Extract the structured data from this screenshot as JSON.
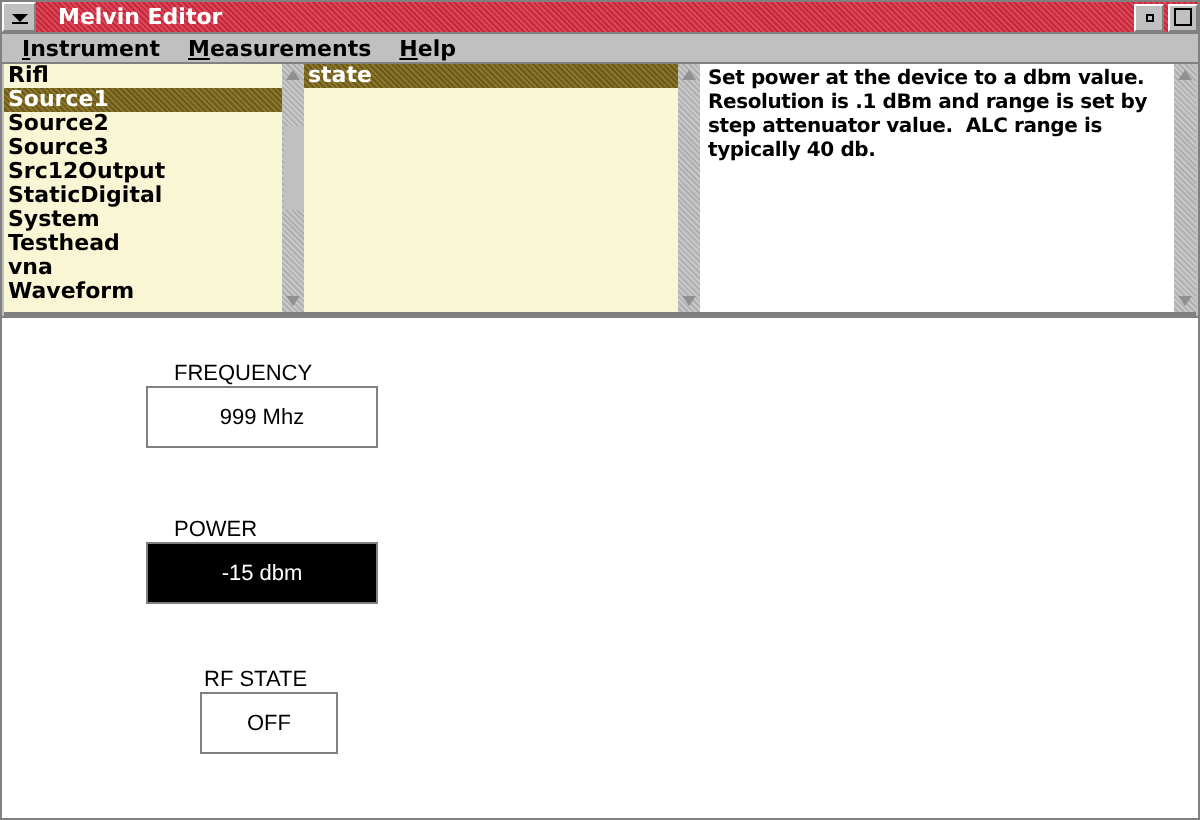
{
  "window": {
    "title": "Melvin Editor"
  },
  "menu": [
    "Instrument",
    "Measurements",
    "Help"
  ],
  "instruments": [
    {
      "label": "Rifl",
      "selected": false
    },
    {
      "label": "Source1",
      "selected": true
    },
    {
      "label": "Source2",
      "selected": false
    },
    {
      "label": "Source3",
      "selected": false
    },
    {
      "label": "Src12Output",
      "selected": false
    },
    {
      "label": "StaticDigital",
      "selected": false
    },
    {
      "label": "System",
      "selected": false
    },
    {
      "label": "Testhead",
      "selected": false
    },
    {
      "label": "vna",
      "selected": false
    },
    {
      "label": "Waveform",
      "selected": false
    }
  ],
  "properties": [
    {
      "label": "state",
      "selected": true
    }
  ],
  "description": "Set power at the device to a dbm value.  Resolution is .1 dBm and range is set by step attenuator value.  ALC range is typically 40 db.",
  "controls": [
    {
      "label": "FREQUENCY",
      "value": "999 Mhz",
      "selected": false
    },
    {
      "label": "POWER",
      "value": "-15 dbm",
      "selected": true
    },
    {
      "label": "RF STATE",
      "value": "OFF",
      "selected": false
    }
  ]
}
